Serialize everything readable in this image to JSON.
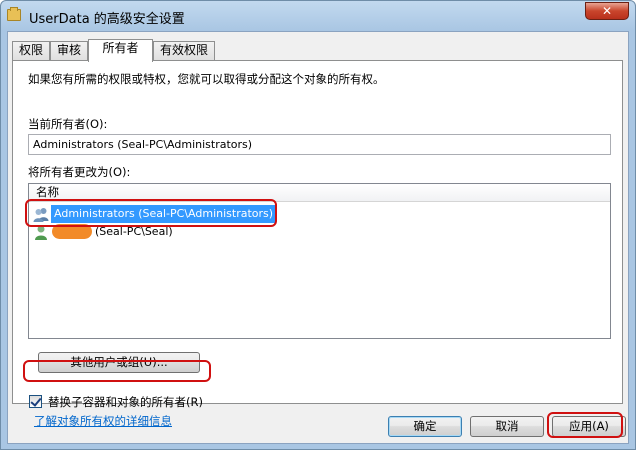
{
  "window": {
    "title": "UserData 的高级安全设置",
    "close_glyph": "✕",
    "icon": "folder-icon"
  },
  "tabs": [
    {
      "label": "权限",
      "active": false
    },
    {
      "label": "审核",
      "active": false
    },
    {
      "label": "所有者",
      "active": true
    },
    {
      "label": "有效权限",
      "active": false
    }
  ],
  "panel": {
    "description": "如果您有所需的权限或特权，您就可以取得或分配这个对象的所有权。",
    "current_owner_label": "当前所有者(O):",
    "current_owner_value": "Administrators (Seal-PC\\Administrators)",
    "change_owner_label": "将所有者更改为(O):",
    "list_header": "名称",
    "rows": [
      {
        "label": "Administrators (Seal-PC\\Administrators)",
        "icon": "group-users-icon",
        "selected": true
      },
      {
        "label": "(Seal-PC\\Seal)",
        "icon": "user-icon",
        "selected": false
      }
    ],
    "other_users_button": "其他用户或组(U)..."
  },
  "replace_owner_checkbox": {
    "label": "替换子容器和对象的所有者(R)",
    "checked": true
  },
  "learn_more_link": "了解对象所有权的详细信息",
  "buttons": {
    "ok": "确定",
    "cancel": "取消",
    "apply": "应用(A)"
  },
  "colors": {
    "selection": "#3399ff",
    "highlight_outline": "#d01010",
    "link": "#0066cc"
  }
}
